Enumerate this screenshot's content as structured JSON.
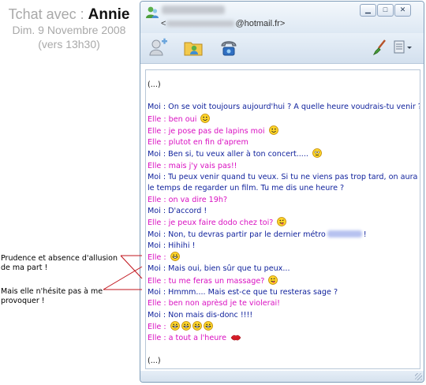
{
  "header": {
    "title_prefix": "Tchat avec :",
    "title_name": "Annie",
    "date": "Dim. 9 Novembre 2008",
    "time": "(vers 13h30)"
  },
  "annotations": [
    {
      "text": "Prudence et absence d'allusion de ma part !"
    },
    {
      "text": "Mais elle n'hésite pas à me provoquer !"
    }
  ],
  "window": {
    "email_prefix": "<",
    "email_suffix": "@hotmail.fr>",
    "buttons": {
      "minimize": "▁",
      "maximize": "□",
      "close": "✕"
    }
  },
  "conversation": {
    "opening": "(...)",
    "closing": "(...)",
    "messages": [
      {
        "text": "Moi : On se voit toujours aujourd'hui ? A quelle heure voudrais-tu venir ?"
      },
      {
        "text": "Elle : ben oui"
      },
      {
        "text": "Elle : je pose pas de lapins moi"
      },
      {
        "text": "Elle : plutot en fin d'aprem"
      },
      {
        "text": "Moi : Ben si, tu veux aller à ton concert....."
      },
      {
        "text": "Elle : mais j'y vais pas!!"
      },
      {
        "text": "Moi : Tu peux venir quand tu veux. Si tu ne viens pas trop tard, on aura le temps de regarder un film. Tu me dis une heure ?"
      },
      {
        "text": "Elle : on va dire 19h?"
      },
      {
        "text": "Moi : D'accord !"
      },
      {
        "text": "Elle : je peux faire dodo chez toi?"
      },
      {
        "text": "Moi : Non, tu devras partir par le dernier métro",
        "after": "!"
      },
      {
        "text": "Moi : Hihihi !"
      },
      {
        "text": "Elle :"
      },
      {
        "text": "Moi : Mais oui, bien sûr que tu peux..."
      },
      {
        "text": "Elle : tu me feras un massage?"
      },
      {
        "text": "Moi : Hmmm.... Mais est-ce que tu resteras sage ?"
      },
      {
        "text": "Elle : ben non aprèsd je te violerai!"
      },
      {
        "text": "Moi : Non mais dis-donc !!!!"
      },
      {
        "text": "Elle :"
      },
      {
        "text": "Elle : a tout a l'heure"
      }
    ]
  },
  "colors": {
    "moi": "#0d1f9b",
    "elle": "#d90fc1",
    "annotation_line": "#c0141c"
  },
  "icons": [
    "contact-icon",
    "invite-icon",
    "send-files-icon",
    "call-icon",
    "brush-icon",
    "menu-icon",
    "smiley-icon",
    "kiss-icon"
  ]
}
